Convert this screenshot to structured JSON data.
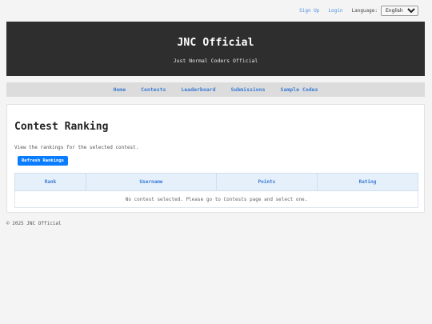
{
  "topbar": {
    "signup_label": "Sign Up",
    "login_label": "Login",
    "language_label": "Language:",
    "language_selected": "English",
    "language_options": [
      "English"
    ]
  },
  "header": {
    "title": "JNC Official",
    "subtitle": "Just Normal Coders Official"
  },
  "nav": {
    "items": [
      {
        "label": "Home"
      },
      {
        "label": "Contests"
      },
      {
        "label": "Leaderboard"
      },
      {
        "label": "Submissions"
      },
      {
        "label": "Sample Codes"
      }
    ]
  },
  "main": {
    "title": "Contest Ranking",
    "description": "View the rankings for the selected contest.",
    "refresh_label": "Refresh Rankings",
    "table": {
      "columns": [
        "Rank",
        "Username",
        "Points",
        "Rating"
      ],
      "empty_message": "No contest selected. Please go to Contests page and select one."
    }
  },
  "footer": {
    "text": "© 2025 JNC Official"
  },
  "colors": {
    "accent": "#0a7cff",
    "link": "#4a90e2",
    "header_bg": "#2e2e2e",
    "nav_bg": "#dcdcdc",
    "table_header_bg": "#e6f0fb"
  }
}
